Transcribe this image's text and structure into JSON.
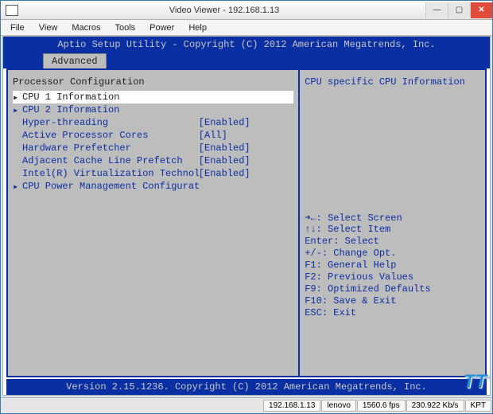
{
  "window": {
    "title": "Video Viewer - 192.168.1.13",
    "min": "—",
    "max": "▢",
    "close": "✕"
  },
  "menubar": [
    "File",
    "View",
    "Macros",
    "Tools",
    "Power",
    "Help"
  ],
  "bios": {
    "header": "Aptio Setup Utility - Copyright (C) 2012 American Megatrends, Inc.",
    "tab": "Advanced",
    "section": "Processor Configuration",
    "options": [
      {
        "arrow": "▸",
        "label": "CPU 1 Information",
        "value": "",
        "selected": true
      },
      {
        "arrow": "▸",
        "label": "CPU 2 Information",
        "value": "",
        "selected": false
      },
      {
        "arrow": "",
        "label": "Hyper-threading",
        "value": "[Enabled]",
        "selected": false
      },
      {
        "arrow": "",
        "label": "Active Processor Cores",
        "value": "[All]",
        "selected": false
      },
      {
        "arrow": "",
        "label": "Hardware Prefetcher",
        "value": "[Enabled]",
        "selected": false
      },
      {
        "arrow": "",
        "label": "Adjacent Cache Line Prefetch",
        "value": "[Enabled]",
        "selected": false
      },
      {
        "arrow": "",
        "label": "Intel(R) Virtualization Technology",
        "value": "[Enabled]",
        "selected": false
      },
      {
        "arrow": "▸",
        "label": "CPU Power Management Configuration",
        "value": "",
        "selected": false
      }
    ],
    "help": "CPU specific CPU Information",
    "keys": [
      "➜←: Select Screen",
      "↑↓: Select Item",
      "Enter: Select",
      "+/-: Change Opt.",
      "F1: General Help",
      "F2: Previous Values",
      "F9: Optimized Defaults",
      "F10: Save & Exit",
      "ESC: Exit"
    ],
    "footer": "Version 2.15.1236. Copyright (C) 2012 American Megatrends, Inc."
  },
  "statusbar": {
    "ip": "192.168.1.13",
    "user": "lenovo",
    "fps": "1560.6 fps",
    "rate": "230.922 Kb/s",
    "mode": "KPT"
  },
  "watermark": "TT"
}
